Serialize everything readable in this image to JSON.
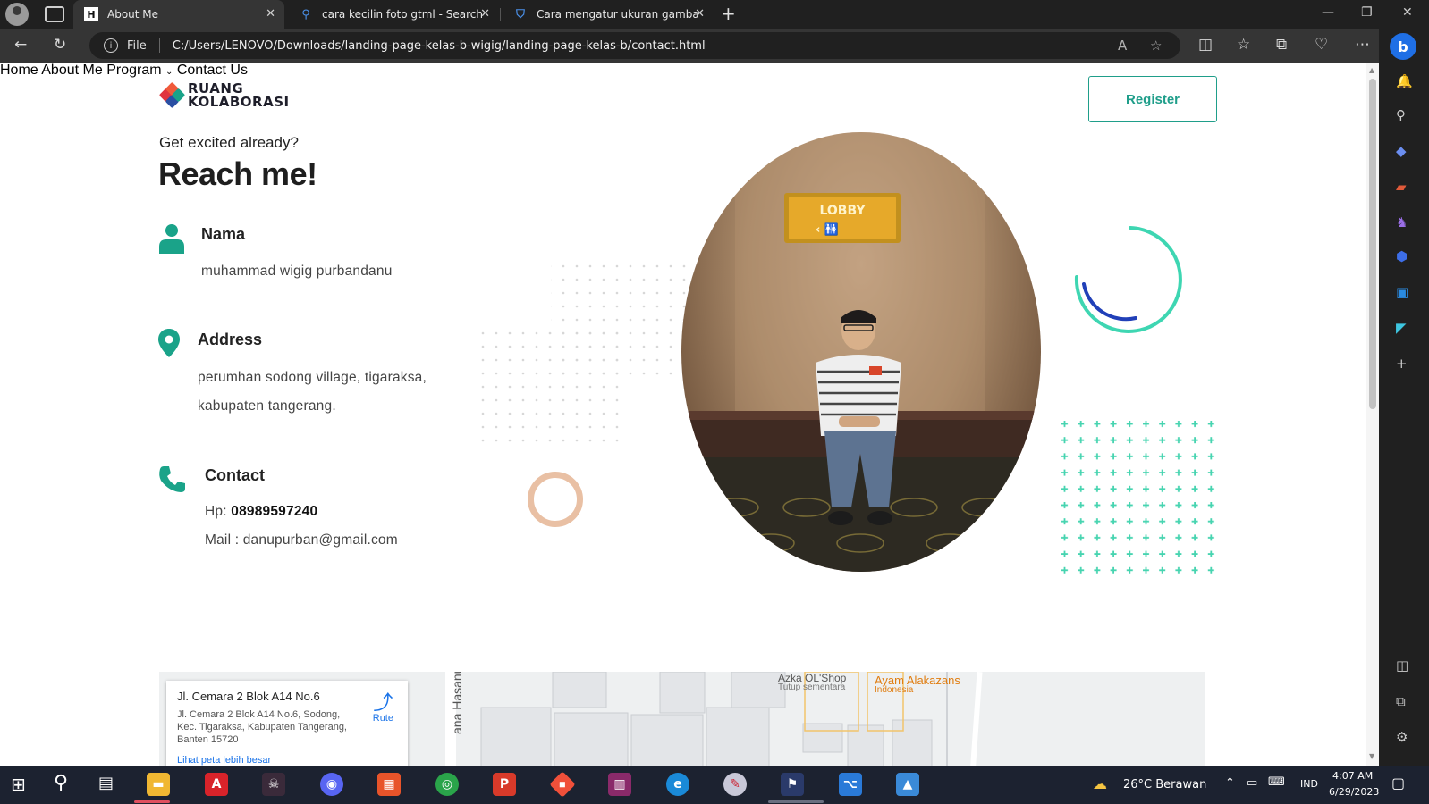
{
  "browser": {
    "tabs": [
      {
        "title": "About Me",
        "favicon": "H",
        "active": true
      },
      {
        "title": "cara kecilin foto gtml - Search",
        "favicon": "search-icon",
        "active": false
      },
      {
        "title": "Cara mengatur ukuran gambar d",
        "favicon": "shield-icon",
        "active": false
      }
    ],
    "address_bar": {
      "scheme_label": "File",
      "url": "C:/Users/LENOVO/Downloads/landing-page-kelas-b-wigig/landing-page-kelas-b/contact.html"
    }
  },
  "site": {
    "logo_line1": "RUANG",
    "logo_line2": "KOLABORASI",
    "nav": {
      "home": "Home",
      "about": "About Me",
      "program": "Program",
      "contact": "Contact Us"
    },
    "register_label": "Register",
    "eyebrow": "Get excited already?",
    "headline": "Reach me!",
    "name_label": "Nama",
    "name_value": "muhammad wigig purbandanu",
    "address_label": "Address",
    "address_line1": "perumhan sodong village, tigaraksa,",
    "address_line2": "kabupaten tangerang.",
    "contact_label": "Contact",
    "phone_prefix": "Hp:",
    "phone_value": "08989597240",
    "mail_line": "Mail : danupurban@gmail.com",
    "photo_sign": "LOBBY",
    "accent_color": "#1aa389"
  },
  "map": {
    "place_title": "Jl. Cemara 2 Blok A14 No.6",
    "place_address": "Jl. Cemara 2 Blok A14 No.6, Sodong, Kec. Tigaraksa, Kabupaten Tangerang, Banten 15720",
    "route_label": "Rute",
    "larger_map_link": "Lihat peta lebih besar",
    "poi_1_name": "Azka OL'Shop",
    "poi_1_status": "Tutup sementara",
    "poi_2_name": "Ayam Alakazans",
    "poi_2_sub": "Indonesia",
    "street_label": "ana Hasanudd"
  },
  "taskbar": {
    "weather": "26°C  Berawan",
    "language": "IND",
    "time": "4:07 AM",
    "date": "6/29/2023"
  }
}
